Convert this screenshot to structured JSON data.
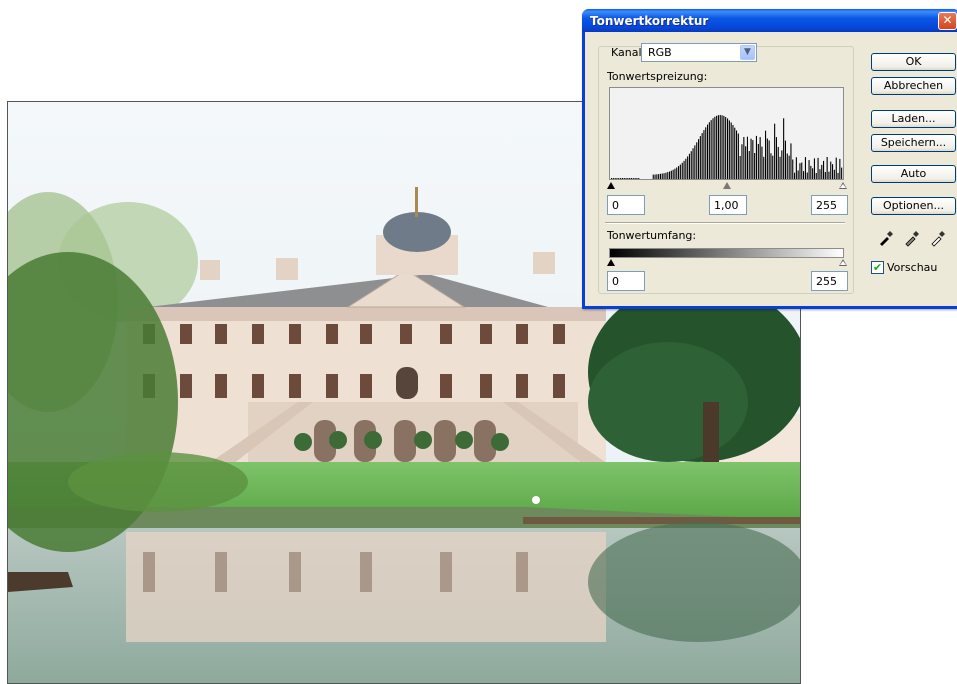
{
  "dialog": {
    "title": "Tonwertkorrektur",
    "channel": {
      "label": "Kanal:",
      "value": "RGB"
    },
    "input_levels": {
      "label": "Tonwertspreizung:",
      "black": "0",
      "gamma": "1,00",
      "white": "255"
    },
    "output_levels": {
      "label": "Tonwertumfang:",
      "black": "0",
      "white": "255"
    },
    "buttons": {
      "ok": "OK",
      "cancel": "Abbrechen",
      "load": "Laden...",
      "save": "Speichern...",
      "auto": "Auto",
      "options": "Optionen..."
    },
    "preview": {
      "label": "Vorschau",
      "checked": true
    },
    "eyedroppers": [
      "black-point-eyedropper-icon",
      "gray-point-eyedropper-icon",
      "white-point-eyedropper-icon"
    ]
  },
  "colors": {
    "xp_title_blue": "#0a57e6",
    "dialog_face": "#ece9d8",
    "close_red": "#d4451f"
  }
}
